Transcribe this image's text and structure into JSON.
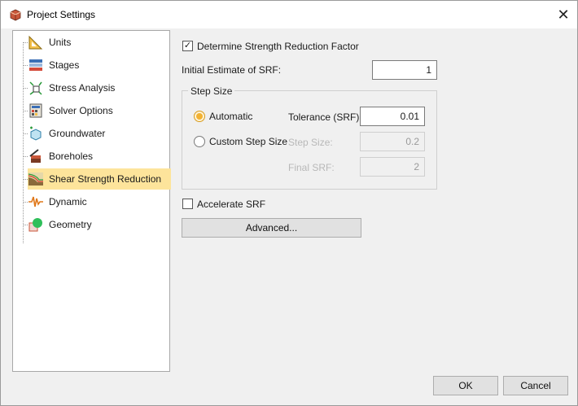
{
  "window": {
    "title": "Project Settings",
    "close_glyph": "✕"
  },
  "tree": {
    "items": [
      {
        "label": "Units",
        "icon": "units-icon"
      },
      {
        "label": "Stages",
        "icon": "stages-icon"
      },
      {
        "label": "Stress Analysis",
        "icon": "stress-analysis-icon"
      },
      {
        "label": "Solver Options",
        "icon": "solver-options-icon"
      },
      {
        "label": "Groundwater",
        "icon": "groundwater-icon"
      },
      {
        "label": "Boreholes",
        "icon": "boreholes-icon"
      },
      {
        "label": "Shear Strength Reduction",
        "icon": "shear-strength-reduction-icon",
        "selected": true
      },
      {
        "label": "Dynamic",
        "icon": "dynamic-icon"
      },
      {
        "label": "Geometry",
        "icon": "geometry-icon"
      }
    ]
  },
  "srf": {
    "determine_label": "Determine Strength Reduction Factor",
    "determine_checked": true,
    "initial_label": "Initial Estimate of SRF:",
    "initial_value": "1",
    "step_size_title": "Step Size",
    "automatic_label": "Automatic",
    "custom_label": "Custom Step Size",
    "mode": "automatic",
    "tolerance_label": "Tolerance (SRF):",
    "tolerance_value": "0.01",
    "step_size_label": "Step Size:",
    "step_size_value": "0.2",
    "final_srf_label": "Final SRF:",
    "final_srf_value": "2",
    "accelerate_label": "Accelerate SRF",
    "accelerate_checked": false,
    "advanced_label": "Advanced..."
  },
  "footer": {
    "ok_label": "OK",
    "cancel_label": "Cancel"
  },
  "colors": {
    "selection": "#fde49b",
    "radio_accent": "#f2b233"
  }
}
